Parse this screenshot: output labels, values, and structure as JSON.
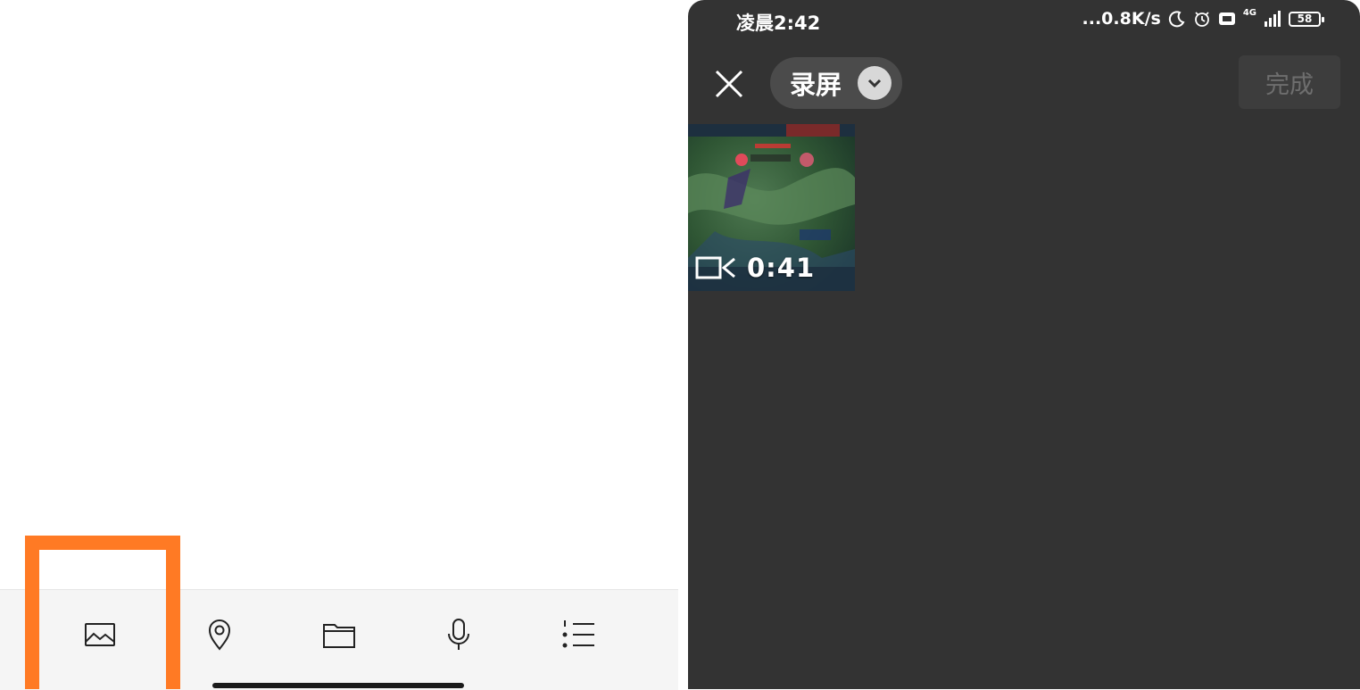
{
  "left": {
    "toolbar": {
      "items": [
        {
          "icon": "image-icon"
        },
        {
          "icon": "location-pin-icon"
        },
        {
          "icon": "folder-icon"
        },
        {
          "icon": "microphone-icon"
        },
        {
          "icon": "numbered-list-icon"
        }
      ],
      "highlight_color": "#ff7a24"
    }
  },
  "phone": {
    "status": {
      "time": "凌晨2:42",
      "network_speed": "...0.8K/s",
      "network_type": "4G",
      "battery": "58"
    },
    "header": {
      "album": "录屏",
      "done_label": "完成"
    },
    "media": [
      {
        "type": "video",
        "duration": "0:41"
      }
    ],
    "colors": {
      "background": "#333333",
      "pill": "#4b4b4b"
    }
  }
}
